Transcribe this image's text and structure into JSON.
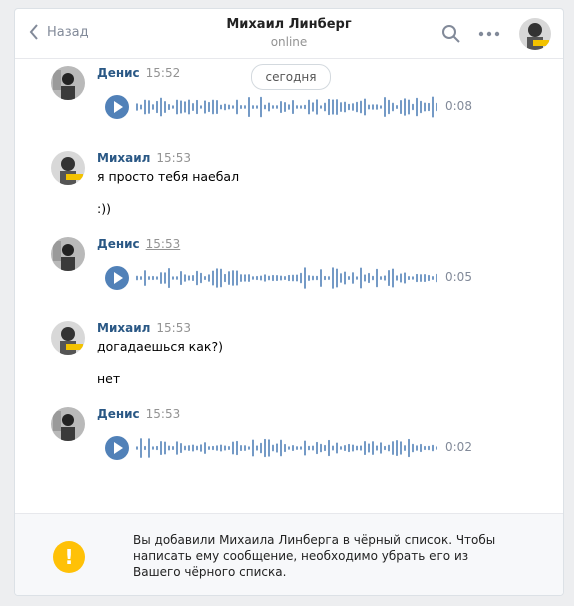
{
  "header": {
    "back_label": "Назад",
    "title": "Михаил Линберг",
    "status": "online"
  },
  "date_separator": "сегодня",
  "messages": [
    {
      "author": "Денис",
      "time": "15:52",
      "type": "voice",
      "duration": "0:08"
    },
    {
      "author": "Михаил",
      "time": "15:53",
      "type": "text",
      "lines": [
        "я просто тебя наебал",
        ":))"
      ]
    },
    {
      "author": "Денис",
      "time": "15:53",
      "type": "voice",
      "duration": "0:05"
    },
    {
      "author": "Михаил",
      "time": "15:53",
      "type": "text",
      "lines": [
        "догадаешься как?)",
        "нет"
      ]
    },
    {
      "author": "Денис",
      "time": "15:53",
      "type": "voice",
      "duration": "0:02"
    }
  ],
  "footer": {
    "text": "Вы добавили Михаила Линберга в чёрный список. Чтобы написать ему сообщение, необходимо убрать его из Вашего чёрного списка.",
    "icon": "!"
  },
  "colors": {
    "accent": "#5181b8",
    "warning": "#ffc107",
    "author": "#2a5885"
  }
}
